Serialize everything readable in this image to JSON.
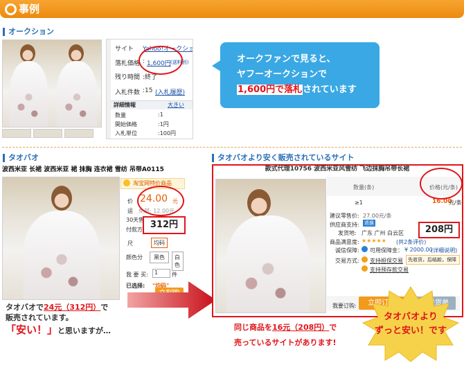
{
  "header": {
    "title": "事例"
  },
  "auction": {
    "section_title": "オークション",
    "fields": {
      "site_label": "サイト",
      "site_value": "Yahoo!オークション",
      "price_label": "落札価格",
      "price_value": "1,600円",
      "price_note": "(送料別)",
      "time_label": "残り時間",
      "time_value": ":終了",
      "bids_label": "入札件数",
      "bids_value": ":15",
      "bids_link": "(入札履歴)",
      "detail_title": "詳細情報",
      "detail_link": "大きい",
      "qty_label": "数量",
      "qty_value": ":1",
      "start_label": "開始価格",
      "start_value": ":1円",
      "unit_label": "入札単位",
      "unit_value": ":100円"
    },
    "bubble": {
      "line1": "オークファンで見ると、",
      "line2": "ヤフーオークションで",
      "price": "1,600円で落札",
      "suffix": "されています"
    }
  },
  "taobao": {
    "section_title": "タオバオ",
    "product_title": "波西米亚 长裙 波西米亚 裙 抹胸 连衣裙 雪纺 吊带A0115",
    "promo": "淘宝网特价商品",
    "price_label": "价",
    "price_value": "24.00",
    "price_unit": "元",
    "ship_label": "运",
    "ship_value": "免邮: 12.00元",
    "days_label": "30天售",
    "pay_label": "付款方",
    "yen_price": "312円",
    "size_label": "尺",
    "size_value": "均码",
    "color_label": "颜色分",
    "color_options": [
      "黑色",
      "白色"
    ],
    "buy_label": "我 要 买:",
    "buy_qty": "1",
    "buy_unit": "件",
    "selected_label": "已选择:",
    "selected_value": "\"均码\"",
    "buy_button": "立刻购",
    "caption": {
      "line1_a": "タオバオで",
      "line1_price": "24元（312円）",
      "line1_b": "で",
      "line2": "販売されています。",
      "quote": "「安い！」",
      "line3": "と思いますが…"
    }
  },
  "cheaper": {
    "section_title": "タオバオより安く販売されているサイト",
    "product_title": "款式代理10756 波西米亚风雪纺 飞边抹胸吊带长裙",
    "qty_header": "数量(条)",
    "price_header": "价格(元/条)",
    "qty_value": "≥1",
    "price_value": "16.00",
    "price_unit": "元/条",
    "retail_label": "建议零售价:",
    "retail_value": "27.00元/条",
    "supplier_label": "供应商支持:",
    "supplier_value": "退换",
    "ship_from_label": "发货地:",
    "ship_from_value": "广东 广州 白云区",
    "yen_price": "208円",
    "rating_label": "商品满意度:",
    "rating_stars": "★★★★★",
    "rating_count": "(共2条评价)",
    "guarantee_label": "诚信保障:",
    "guarantee_value": "可用保障金：",
    "guarantee_amount": "¥ 2000.00",
    "guarantee_link": "(详细说明)",
    "trade_label": "交易方式:",
    "trade_value1": "支持担保交易",
    "trade_value2": "先收货，后结款，保障",
    "trade_value3": "支持预存款交易",
    "buy_label": "我要订购:",
    "buy_qty": "1",
    "buy_unit": "条",
    "buy_button": "立即订购",
    "cart_button": "加入进货单",
    "caption": {
      "line1_a": "同じ商品を",
      "line1_price": "16元（208円）",
      "line1_b": "で",
      "line2": "売っているサイトがあります!"
    },
    "badge": {
      "line1": "タオバオより",
      "line2": "ずっと安い！です"
    }
  }
}
